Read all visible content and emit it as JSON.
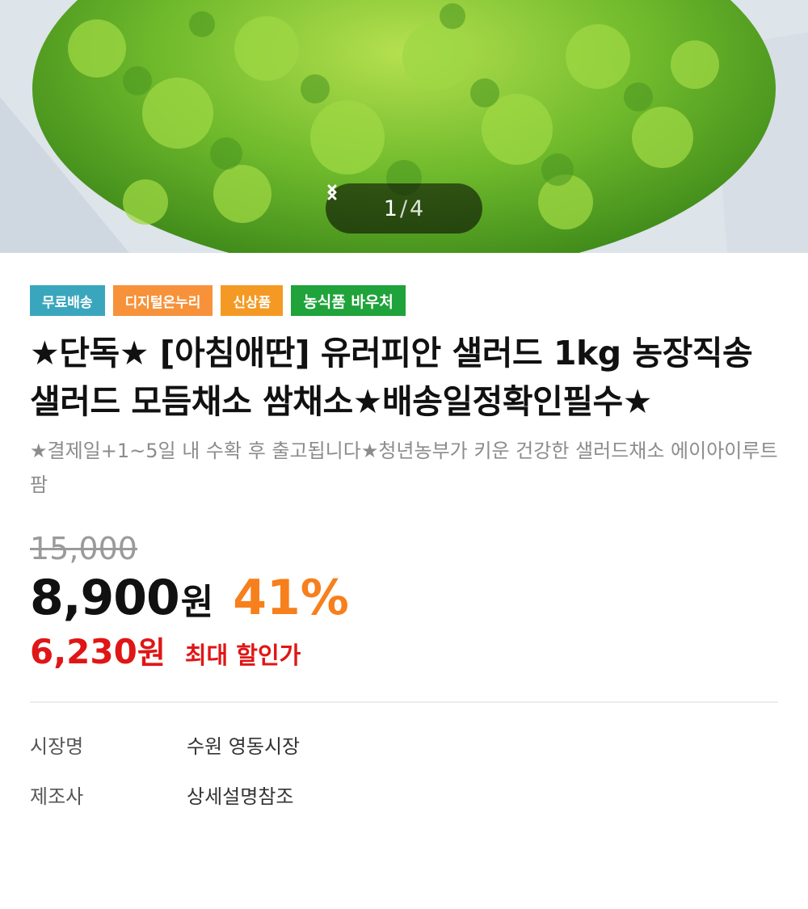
{
  "colors": {
    "badge_free_shipping": "#3aa6be",
    "badge_digital_onnuri": "#f7923a",
    "badge_new": "#f49a24",
    "badge_voucher": "#1fa33a",
    "discount_rate": "#f77f1c",
    "max_discount": "#e01616"
  },
  "gallery": {
    "current": "1",
    "separator": "/",
    "total": "4",
    "prev_icon": "chevron-left-icon",
    "next_icon": "chevron-right-icon"
  },
  "badges": [
    "무료배송",
    "디지털온누리",
    "신상품",
    "농식품 바우처"
  ],
  "product": {
    "title": "★단독★ [아침애딴] 유러피안 샐러드 1kg 농장직송 샐러드 모듬채소 쌈채소★배송일정확인필수★",
    "subtitle": "★결제일+1~5일 내 수확 후 출고됩니다★청년농부가 키운 건강한 샐러드채소 에이아이루트팜",
    "original_price": "15,000",
    "sale_price": "8,900",
    "currency": "원",
    "discount_rate": "41%",
    "max_discount_price": "6,230",
    "max_discount_label": "최대 할인가"
  },
  "info": [
    {
      "label": "시장명",
      "value": "수원 영동시장"
    },
    {
      "label": "제조사",
      "value": "상세설명참조"
    }
  ]
}
